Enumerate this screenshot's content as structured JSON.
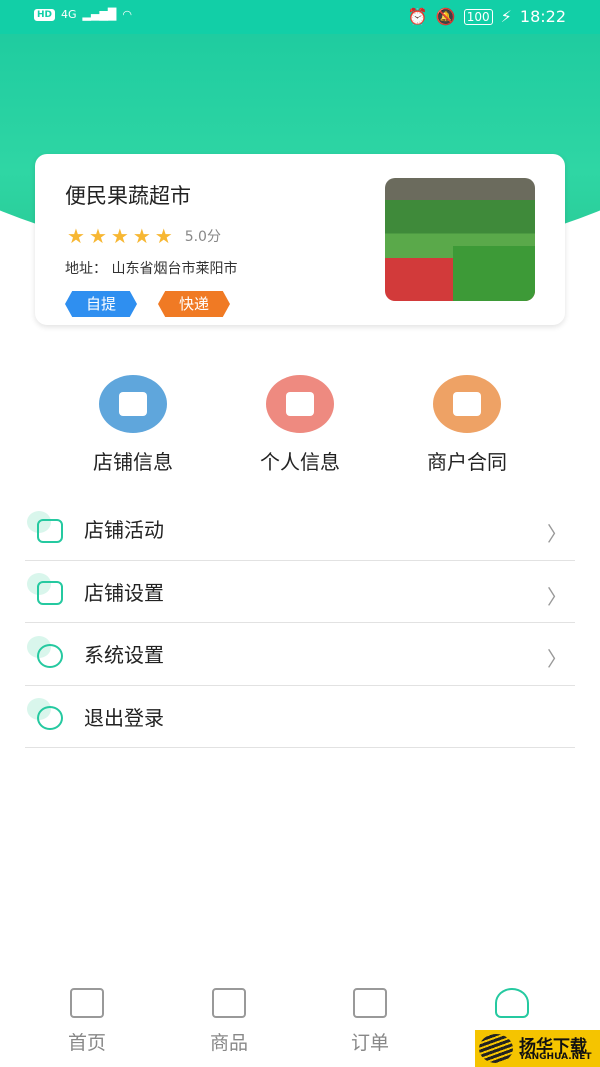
{
  "status": {
    "time": "18:22",
    "battery": "100",
    "network": "4G",
    "hd": "HD"
  },
  "store": {
    "name": "便民果蔬超市",
    "rating": 5,
    "score": "5.0分",
    "address": "地址：  山东省烟台市莱阳市",
    "tags": [
      {
        "label": "自提",
        "color": "#2f8ff0"
      },
      {
        "label": "快递",
        "color": "#f07a24"
      }
    ]
  },
  "quick": [
    {
      "label": "店铺信息",
      "color": "#5fa6dc"
    },
    {
      "label": "个人信息",
      "color": "#ee8a80"
    },
    {
      "label": "商户合同",
      "color": "#eea265"
    }
  ],
  "menu": [
    {
      "label": "店铺活动",
      "icon": "gift-icon"
    },
    {
      "label": "店铺设置",
      "icon": "store-settings-icon"
    },
    {
      "label": "系统设置",
      "icon": "gear-icon"
    },
    {
      "label": "退出登录",
      "icon": "power-icon"
    }
  ],
  "tabs": [
    {
      "label": "首页"
    },
    {
      "label": "商品"
    },
    {
      "label": "订单"
    }
  ],
  "accent": "#25c9a0",
  "watermark": {
    "title": "扬华下载",
    "url": "YANGHUA.NET"
  }
}
